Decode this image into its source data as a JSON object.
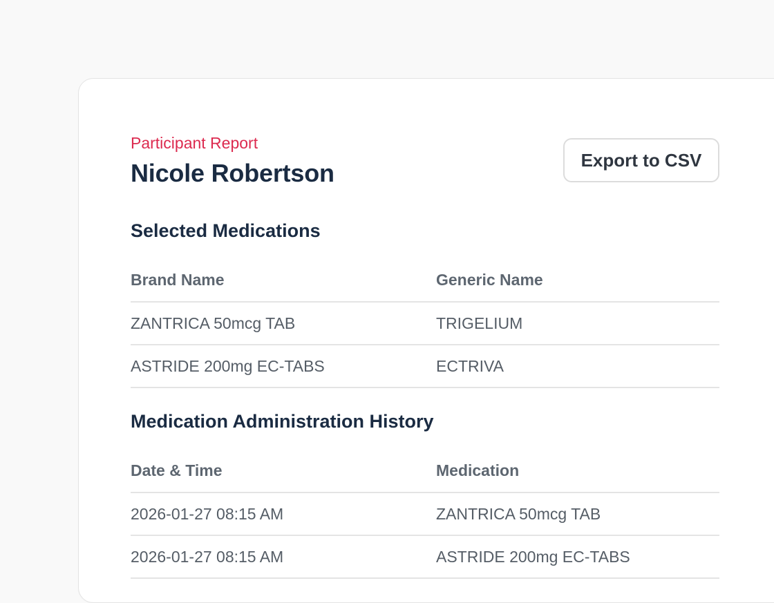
{
  "header": {
    "eyebrow": "Participant Report",
    "participant_name": "Nicole Robertson",
    "export_label": "Export to CSV"
  },
  "selected_medications": {
    "title": "Selected Medications",
    "columns": [
      "Brand Name",
      "Generic Name"
    ],
    "rows": [
      [
        "ZANTRICA 50mcg TAB",
        "TRIGELIUM"
      ],
      [
        "ASTRIDE 200mg EC-TABS",
        "ECTRIVA"
      ]
    ]
  },
  "administration_history": {
    "title": "Medication Administration History",
    "columns": [
      "Date & Time",
      "Medication"
    ],
    "rows": [
      [
        "2026-01-27 08:15 AM",
        "ZANTRICA 50mcg TAB"
      ],
      [
        "2026-01-27 08:15 AM",
        "ASTRIDE 200mg EC-TABS"
      ]
    ]
  },
  "colors": {
    "accent": "#dc2a4f",
    "heading": "#1a2b42",
    "muted_text": "#5d6670",
    "border": "#e4e4e4"
  }
}
